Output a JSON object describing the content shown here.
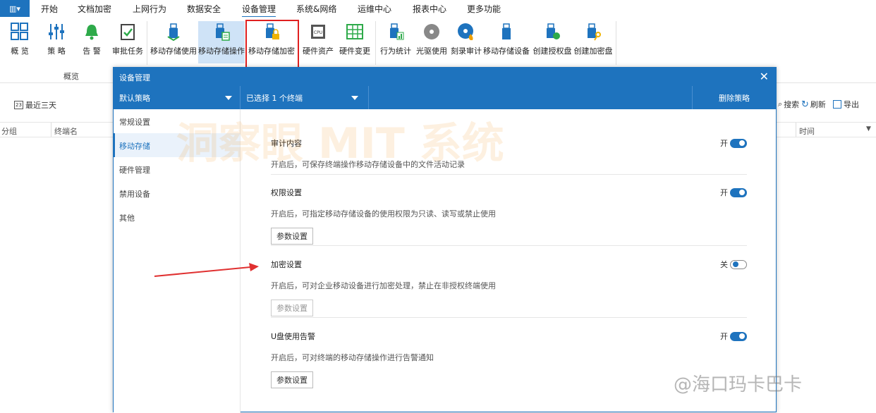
{
  "menubar": {
    "items": [
      "开始",
      "文档加密",
      "上网行为",
      "数据安全",
      "设备管理",
      "系统&网络",
      "运维中心",
      "报表中心",
      "更多功能"
    ],
    "active": "设备管理"
  },
  "ribbon": {
    "buttons": [
      {
        "label": "概 览",
        "icon": "overview-grid-icon"
      },
      {
        "label": "策 略",
        "icon": "sliders-icon"
      },
      {
        "label": "告 警",
        "icon": "bell-icon"
      },
      {
        "label": "审批任务",
        "icon": "clipboard-check-icon"
      },
      {
        "label": "移动存储使用",
        "icon": "usb-download-icon"
      },
      {
        "label": "移动存储操作",
        "icon": "usb-doc-icon"
      },
      {
        "label": "移动存储加密",
        "icon": "usb-lock-icon"
      },
      {
        "label": "硬件资产",
        "icon": "cpu-icon"
      },
      {
        "label": "硬件变更",
        "icon": "grid-table-icon"
      },
      {
        "label": "行为统计",
        "icon": "usb-stats-icon"
      },
      {
        "label": "光驱使用",
        "icon": "disc-icon"
      },
      {
        "label": "刻录审计",
        "icon": "disc-fire-icon"
      },
      {
        "label": "移动存储设备",
        "icon": "usb-icon"
      },
      {
        "label": "创建授权盘",
        "icon": "usb-plus-icon"
      },
      {
        "label": "创建加密盘",
        "icon": "usb-key-icon"
      }
    ],
    "group_label": "概览"
  },
  "background": {
    "date_filter": "最近三天",
    "col_group": "分组",
    "col_terminal": "终端名",
    "col_time": "时间",
    "search": "搜索",
    "refresh": "刷新",
    "export": "导出"
  },
  "modal": {
    "title": "设备管理",
    "policy_select": "默认策略",
    "selected_terminals": "已选择 1 个终端",
    "delete_policy": "删除策略",
    "sidebar": [
      "常规设置",
      "移动存储",
      "硬件管理",
      "禁用设备",
      "其他"
    ],
    "sidebar_active": "移动存储",
    "sections": [
      {
        "title": "审计内容",
        "desc": "开启后，可保存终端操作移动存储设备中的文件活动记录",
        "state": "开",
        "on": true,
        "button": ""
      },
      {
        "title": "权限设置",
        "desc": "开启后，可指定移动存储设备的使用权限为只读、读写或禁止使用",
        "state": "开",
        "on": true,
        "button": "参数设置"
      },
      {
        "title": "加密设置",
        "desc": "开启后，可对企业移动设备进行加密处理，禁止在非授权终端使用",
        "state": "关",
        "on": false,
        "button": "参数设置"
      },
      {
        "title": "U盘使用告警",
        "desc": "开启后，可对终端的移动存储操作进行告警通知",
        "state": "开",
        "on": true,
        "button": "参数设置"
      }
    ]
  },
  "watermark": "洞察眼 MIT 系统",
  "brand": "@海口玛卡巴卡",
  "colors": {
    "accent": "#1e73be",
    "highlight_box": "#e02020",
    "arrow": "#e03030"
  }
}
